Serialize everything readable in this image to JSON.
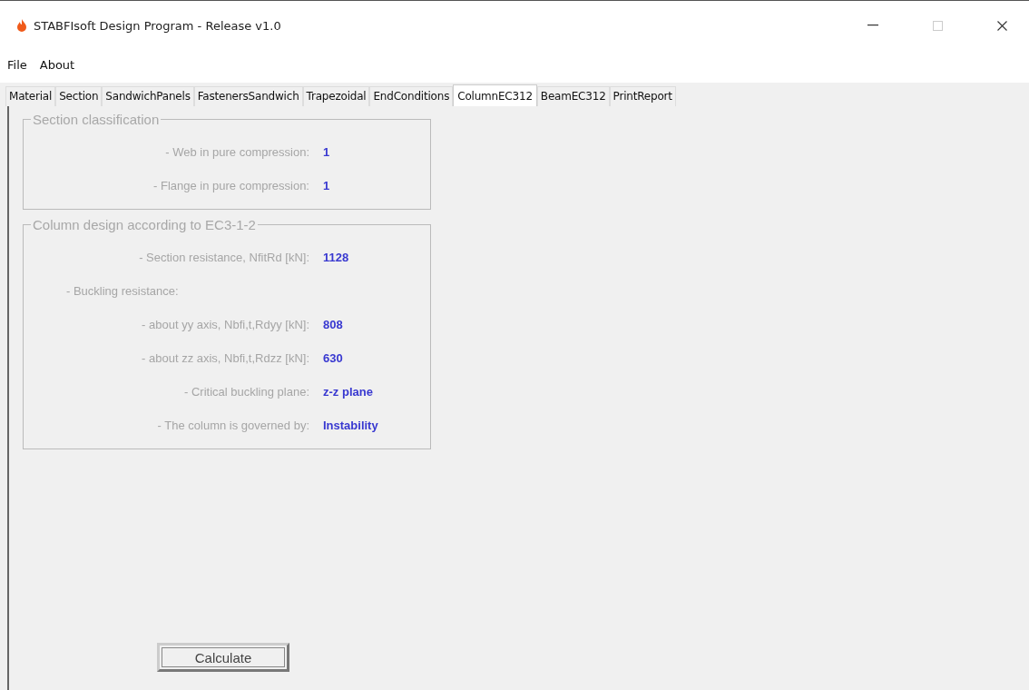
{
  "window": {
    "title": "STABFIsoft Design Program - Release v1.0"
  },
  "menu": [
    "File",
    "About"
  ],
  "tabs": [
    {
      "label": "Material",
      "selected": false
    },
    {
      "label": "Section",
      "selected": false
    },
    {
      "label": "SandwichPanels",
      "selected": false
    },
    {
      "label": "FastenersSandwich",
      "selected": false
    },
    {
      "label": "Trapezoidal",
      "selected": false
    },
    {
      "label": "EndConditions",
      "selected": false
    },
    {
      "label": "ColumnEC312",
      "selected": true
    },
    {
      "label": "BeamEC312",
      "selected": false
    },
    {
      "label": "PrintReport",
      "selected": false
    }
  ],
  "groups": [
    {
      "title": "Section classification",
      "rows": [
        {
          "kind": "value",
          "label": "- Web in pure compression:",
          "value": "1"
        },
        {
          "kind": "value",
          "label": "- Flange in pure compression:",
          "value": "1"
        }
      ]
    },
    {
      "title": "Column design according to EC3-1-2",
      "rows": [
        {
          "kind": "value",
          "label": "- Section resistance, NfitRd [kN]:",
          "value": "1128"
        },
        {
          "kind": "heading",
          "label": "- Buckling resistance:"
        },
        {
          "kind": "value",
          "label": "- about yy axis, Nbfi,t,Rdyy [kN]:",
          "value": "808"
        },
        {
          "kind": "value",
          "label": "- about zz axis, Nbfi,t,Rdzz [kN]:",
          "value": "630"
        },
        {
          "kind": "value",
          "label": "- Critical buckling plane:",
          "value": "z-z plane"
        },
        {
          "kind": "value",
          "label": "- The column is governed by:",
          "value": "Instability"
        }
      ]
    }
  ],
  "calculate_button": "Calculate"
}
